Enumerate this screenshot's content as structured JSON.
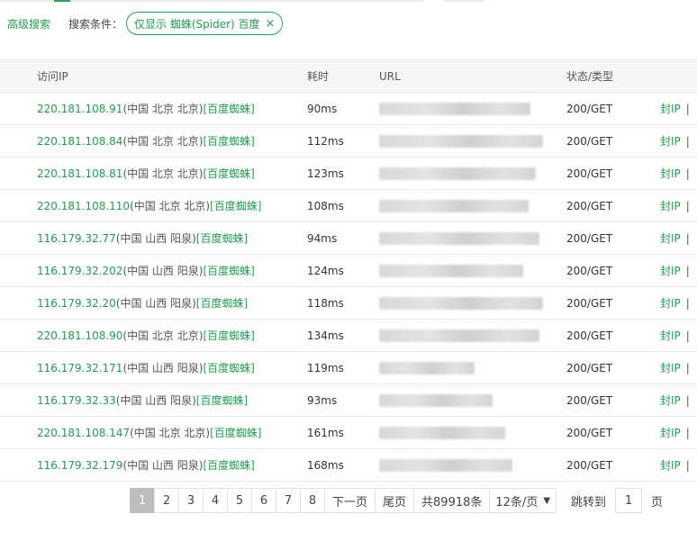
{
  "filter": {
    "advanced_label": "高级搜索",
    "condition_label": "搜索条件：",
    "tag_label": "仅显示 蜘蛛(Spider) 百度",
    "tag_close": "×"
  },
  "table": {
    "headers": {
      "ip": "访问IP",
      "time": "耗时",
      "url": "URL",
      "status": "状态/类型"
    },
    "rows": [
      {
        "ip": "220.181.108.91",
        "loc": "(中国 北京 北京)",
        "spider": "[百度蜘蛛]",
        "time": "90ms",
        "url": "",
        "status": "200/GET",
        "action": "封IP",
        "sep": "|"
      },
      {
        "ip": "220.181.108.84",
        "loc": "(中国 北京 北京)",
        "spider": "[百度蜘蛛]",
        "time": "112ms",
        "url": "",
        "status": "200/GET",
        "action": "封IP",
        "sep": "|"
      },
      {
        "ip": "220.181.108.81",
        "loc": "(中国 北京 北京)",
        "spider": "[百度蜘蛛]",
        "time": "123ms",
        "url": "",
        "status": "200/GET",
        "action": "封IP",
        "sep": "|"
      },
      {
        "ip": "220.181.108.110",
        "loc": "(中国 北京 北京)",
        "spider": "[百度蜘蛛]",
        "time": "108ms",
        "url": "",
        "status": "200/GET",
        "action": "封IP",
        "sep": "|"
      },
      {
        "ip": "116.179.32.77",
        "loc": "(中国 山西 阳泉)",
        "spider": "[百度蜘蛛]",
        "time": "94ms",
        "url": "",
        "status": "200/GET",
        "action": "封IP",
        "sep": "|"
      },
      {
        "ip": "116.179.32.202",
        "loc": "(中国 山西 阳泉)",
        "spider": "[百度蜘蛛]",
        "time": "124ms",
        "url": "",
        "status": "200/GET",
        "action": "封IP",
        "sep": "|"
      },
      {
        "ip": "116.179.32.20",
        "loc": "(中国 山西 阳泉)",
        "spider": "[百度蜘蛛]",
        "time": "118ms",
        "url": "",
        "status": "200/GET",
        "action": "封IP",
        "sep": "|"
      },
      {
        "ip": "220.181.108.90",
        "loc": "(中国 北京 北京)",
        "spider": "[百度蜘蛛]",
        "time": "134ms",
        "url": "",
        "status": "200/GET",
        "action": "封IP",
        "sep": "|"
      },
      {
        "ip": "116.179.32.171",
        "loc": "(中国 山西 阳泉)",
        "spider": "[百度蜘蛛]",
        "time": "119ms",
        "url": "",
        "status": "200/GET",
        "action": "封IP",
        "sep": "|"
      },
      {
        "ip": "116.179.32.33",
        "loc": "(中国 山西 阳泉)",
        "spider": "[百度蜘蛛]",
        "time": "93ms",
        "url": "",
        "status": "200/GET",
        "action": "封IP",
        "sep": "|"
      },
      {
        "ip": "220.181.108.147",
        "loc": "(中国 北京 北京)",
        "spider": "[百度蜘蛛]",
        "time": "161ms",
        "url": "",
        "status": "200/GET",
        "action": "封IP",
        "sep": "|"
      },
      {
        "ip": "116.179.32.179",
        "loc": "(中国 山西 阳泉)",
        "spider": "[百度蜘蛛]",
        "time": "168ms",
        "url": "",
        "status": "200/GET",
        "action": "封IP",
        "sep": "|"
      }
    ]
  },
  "pagination": {
    "pages": [
      "1",
      "2",
      "3",
      "4",
      "5",
      "6",
      "7",
      "8"
    ],
    "current": "1",
    "next": "下一页",
    "last": "尾页",
    "total": "共89918条",
    "page_size": "12条/页",
    "jump_label": "跳转到",
    "jump_value": "1",
    "jump_unit": "页"
  },
  "colors": {
    "accent": "#1f9e4f",
    "active_page": "#bdbdbd"
  }
}
